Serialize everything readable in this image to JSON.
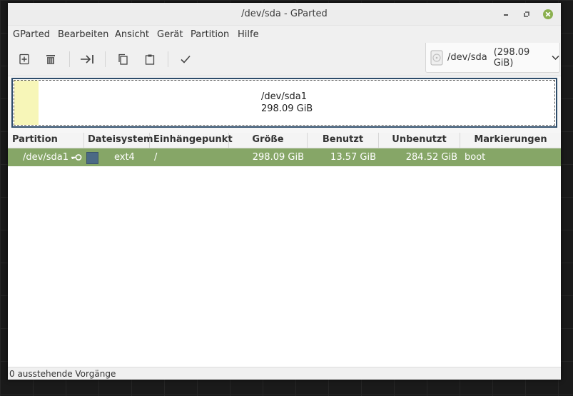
{
  "window": {
    "title": "/dev/sda - GParted"
  },
  "menubar": {
    "items": [
      "GParted",
      "Bearbeiten",
      "Ansicht",
      "Gerät",
      "Partition",
      "Hilfe"
    ]
  },
  "toolbar": {
    "device_path": "/dev/sda",
    "device_size": "(298.09 GiB)"
  },
  "disk_map": {
    "partition": "/dev/sda1",
    "size": "298.09 GiB",
    "used_fraction": 0.0455
  },
  "table": {
    "columns": [
      "Partition",
      "Dateisystem",
      "Einhängepunkt",
      "Größe",
      "Benutzt",
      "Unbenutzt",
      "Markierungen"
    ],
    "rows": [
      {
        "partition": "/dev/sda1",
        "filesystem": "ext4",
        "mountpoint": "/",
        "size": "298.09 GiB",
        "used": "13.57 GiB",
        "unused": "284.52 GiB",
        "flags": "boot"
      }
    ]
  },
  "status": {
    "text": "0 ausstehende Vorgänge"
  },
  "colors": {
    "selected_row": "#86a667",
    "ext4": "#4b6985",
    "used_space": "#f7f6b8",
    "map_border": "#2e4d6b",
    "close_button": "#8bb04f"
  }
}
